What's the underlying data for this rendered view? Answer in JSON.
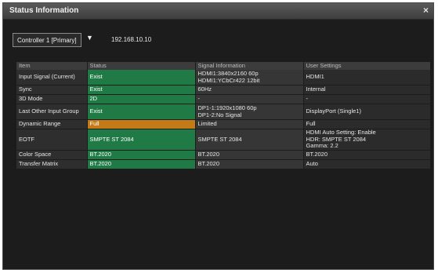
{
  "window": {
    "title": "Status Information",
    "close_glyph": "×"
  },
  "toolbar": {
    "controller_select": "Controller 1 [Primary]",
    "dropdown_glyph": "▼",
    "ip_address": "192.168.10.10"
  },
  "table": {
    "headers": [
      "Item",
      "Status",
      "Signal Information",
      "User Settings"
    ],
    "rows": [
      {
        "item": "Input Signal (Current)",
        "status": "Exist",
        "status_state": "ok",
        "signal": [
          "HDMI1:3840x2160 60p",
          "HDMI1:YCbCr422 12bit"
        ],
        "user": [
          "HDMI1"
        ]
      },
      {
        "item": "Sync",
        "status": "Exist",
        "status_state": "ok",
        "signal": [
          "60Hz"
        ],
        "user": [
          "Internal"
        ]
      },
      {
        "item": "3D Mode",
        "status": "2D",
        "status_state": "ok",
        "signal": [
          "-"
        ],
        "user": [
          "-"
        ]
      },
      {
        "item": "Last Other Input Group",
        "status": "Exist",
        "status_state": "ok",
        "signal": [
          "DP1-1:1920x1080 60p",
          "DP1-2:No Signal"
        ],
        "user": [
          "DisplayPort (Single1)"
        ]
      },
      {
        "item": "Dynamic Range",
        "status": "Full",
        "status_state": "fail",
        "signal": [
          "Limited"
        ],
        "user": [
          "Full"
        ]
      },
      {
        "item": "EOTF",
        "status": "SMPTE ST 2084",
        "status_state": "ok",
        "signal": [
          "SMPTE ST 2084"
        ],
        "user": [
          "HDMI Auto Setting: Enable",
          "HDR: SMPTE ST 2084",
          "Gamma: 2.2"
        ]
      },
      {
        "item": "Color Space",
        "status": "BT.2020",
        "status_state": "ok",
        "signal": [
          "BT.2020"
        ],
        "user": [
          "BT.2020"
        ]
      },
      {
        "item": "Transfer Matrix",
        "status": "BT.2020",
        "status_state": "ok",
        "signal": [
          "BT.2020"
        ],
        "user": [
          "Auto"
        ]
      }
    ]
  }
}
